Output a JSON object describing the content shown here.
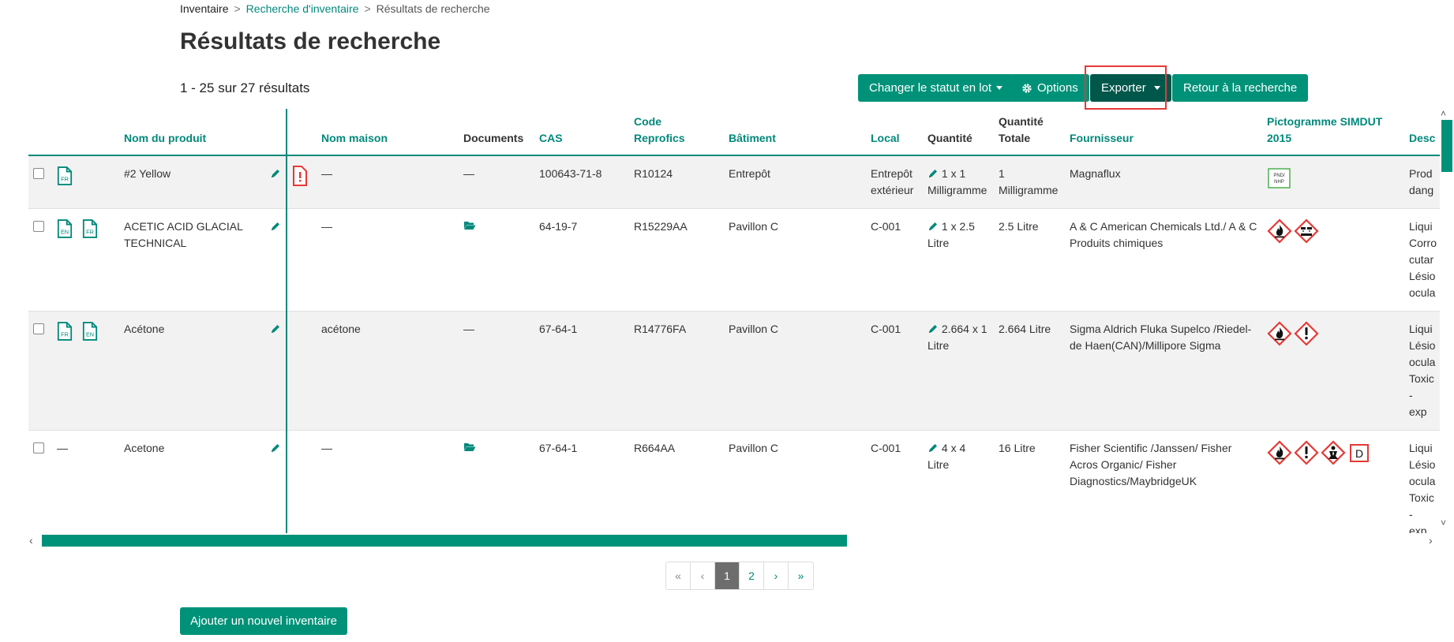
{
  "breadcrumb": [
    "Inventaire",
    "Recherche d'inventaire",
    "Résultats de recherche"
  ],
  "page_title": "Résultats de recherche",
  "results_count": "1 - 25 sur 27 résultats",
  "toolbar": {
    "batch_status": "Changer le statut en lot",
    "options": "Options",
    "export": "Exporter",
    "back": "Retour à la recherche"
  },
  "columns": {
    "product": "Nom du produit",
    "house": "Nom maison",
    "documents": "Documents",
    "cas": "CAS",
    "reprofics_1": "Code",
    "reprofics_2": "Reprofics",
    "building": "Bâtiment",
    "local": "Local",
    "qty": "Quantité",
    "total_1": "Quantité",
    "total_2": "Totale",
    "supplier": "Fournisseur",
    "picto_1": "Pictogramme SIMDUT",
    "picto_2": "2015",
    "desc": "Desc"
  },
  "rows": [
    {
      "docs": [
        "FR"
      ],
      "product": "#2 Yellow",
      "flag": true,
      "house": "—",
      "documents": "—",
      "doc_folder": false,
      "cas": "100643-71-8",
      "reprofics": "R10124",
      "building": "Entrepôt",
      "local": "Entrepôt extérieur",
      "qty": "1 x 1 Milligramme",
      "total": "1 Milligramme",
      "supplier": "Magnaflux",
      "pictos": [
        "pnd-nhp"
      ],
      "desc": "Prod dang"
    },
    {
      "docs": [
        "EN",
        "FR"
      ],
      "product": "ACETIC ACID GLACIAL TECHNICAL",
      "flag": false,
      "house": "—",
      "documents": "",
      "doc_folder": true,
      "cas": "64-19-7",
      "reprofics": "R15229AA",
      "building": "Pavillon C",
      "local": "C-001",
      "qty": "1 x 2.5 Litre",
      "total": "2.5 Litre",
      "supplier": "A & C American Chemicals Ltd./ A & C Produits chimiques",
      "pictos": [
        "flame",
        "corrosion"
      ],
      "desc": "Liqui Corro cutar Lésio ocula"
    },
    {
      "docs": [
        "FR",
        "EN"
      ],
      "product": "Acétone",
      "flag": false,
      "house": "acétone",
      "documents": "—",
      "doc_folder": false,
      "cas": "67-64-1",
      "reprofics": "R14776FA",
      "building": "Pavillon C",
      "local": "C-001",
      "qty": "2.664 x 1 Litre",
      "total": "2.664 Litre",
      "supplier": "Sigma Aldrich Fluka Supelco /Riedel-de Haen(CAN)/Millipore Sigma",
      "pictos": [
        "flame",
        "exclamation"
      ],
      "desc": "Liqui Lésio ocula Toxic - exp"
    },
    {
      "docs": [],
      "docs_empty": "—",
      "product": "Acetone",
      "flag": false,
      "house": "—",
      "documents": "",
      "doc_folder": true,
      "cas": "67-64-1",
      "reprofics": "R664AA",
      "building": "Pavillon C",
      "local": "C-001",
      "qty": "4 x 4 Litre",
      "total": "16 Litre",
      "supplier": "Fisher Scientific /Janssen/ Fisher Acros Organic/ Fisher Diagnostics/MaybridgeUK",
      "pictos": [
        "flame",
        "exclamation",
        "health",
        "D"
      ],
      "desc": "Liqui Lésio ocula Toxic - exp Toxic - exp"
    }
  ],
  "picto_labels": {
    "pnd": "PND/",
    "nhp": "NHP",
    "d": "D"
  },
  "pagination": {
    "first": "«",
    "prev": "‹",
    "pages": [
      "1",
      "2"
    ],
    "next": "›",
    "last": "»",
    "current": "1"
  },
  "add_button": "Ajouter un nouvel inventaire",
  "colors": {
    "accent": "#009279",
    "accent_dark": "#00574a",
    "danger": "#e53935"
  }
}
